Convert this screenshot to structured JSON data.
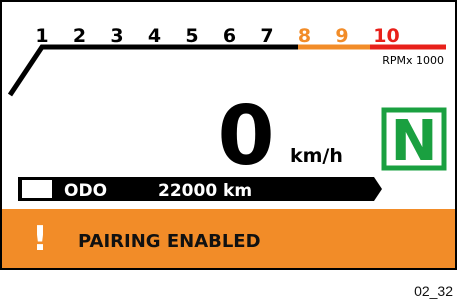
{
  "tachometer": {
    "ticks": [
      {
        "label": "1",
        "color": "#000000"
      },
      {
        "label": "2",
        "color": "#000000"
      },
      {
        "label": "3",
        "color": "#000000"
      },
      {
        "label": "4",
        "color": "#000000"
      },
      {
        "label": "5",
        "color": "#000000"
      },
      {
        "label": "6",
        "color": "#000000"
      },
      {
        "label": "7",
        "color": "#000000"
      },
      {
        "label": "8",
        "color": "#f28c28"
      },
      {
        "label": "9",
        "color": "#f28c28"
      },
      {
        "label": "10",
        "color": "#e8201a"
      }
    ],
    "unit": "RPMx 1000"
  },
  "speed": {
    "value": "0",
    "unit": "km/h"
  },
  "gear": {
    "value": "N",
    "color": "#1aa040"
  },
  "odometer": {
    "label": "ODO",
    "value": "22000 km"
  },
  "alert": {
    "icon": "exclamation-icon",
    "text": "PAIRING ENABLED",
    "color": "#f28c28"
  },
  "caption": "02_32"
}
